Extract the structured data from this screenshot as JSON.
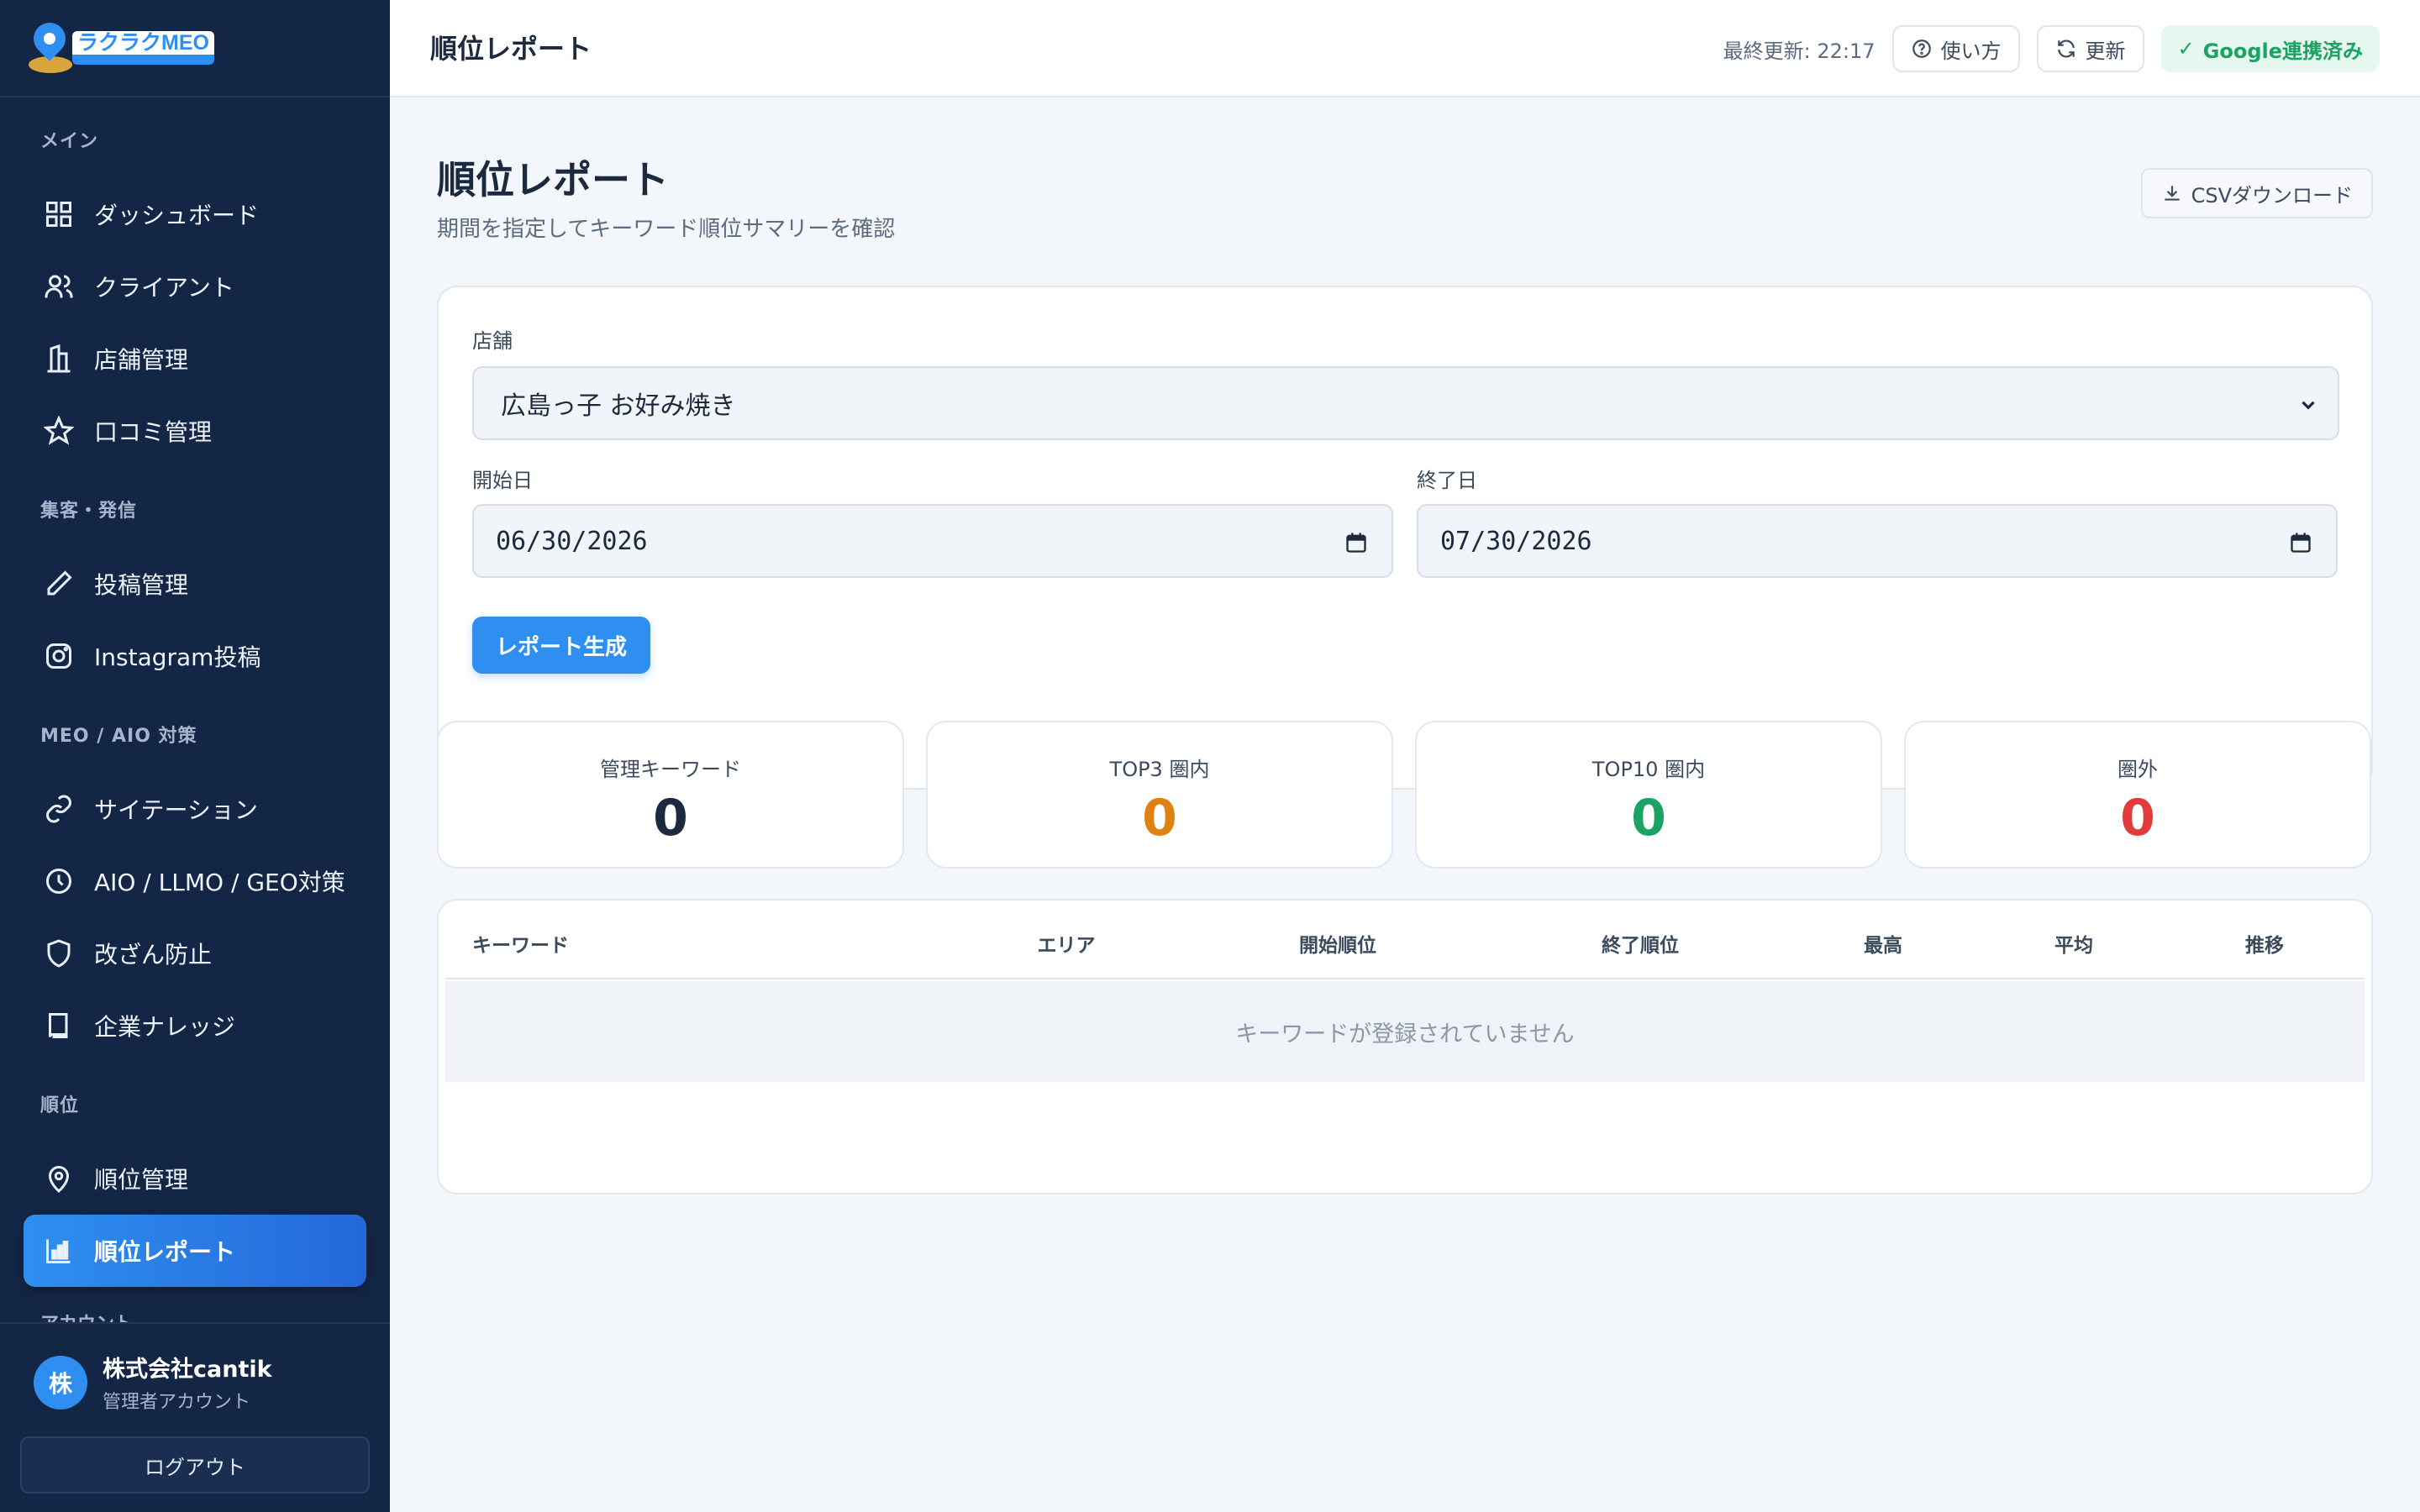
{
  "app": {
    "logo_text": "ラクラクMEO"
  },
  "sidebar": {
    "sections": [
      {
        "label": "メイン"
      },
      {
        "label": "集客・発信"
      },
      {
        "label": "MEO / AIO 対策"
      },
      {
        "label": "順位"
      },
      {
        "label": "アカウント"
      }
    ],
    "items": [
      {
        "label": "ダッシュボード",
        "icon": "grid-icon"
      },
      {
        "label": "クライアント",
        "icon": "users-icon"
      },
      {
        "label": "店舗管理",
        "icon": "building-icon"
      },
      {
        "label": "口コミ管理",
        "icon": "star-icon"
      },
      {
        "label": "投稿管理",
        "icon": "pencil-icon"
      },
      {
        "label": "Instagram投稿",
        "icon": "instagram-icon"
      },
      {
        "label": "サイテーション",
        "icon": "link-icon"
      },
      {
        "label": "AIO / LLMO / GEO対策",
        "icon": "clock-icon"
      },
      {
        "label": "改ざん防止",
        "icon": "shield-icon"
      },
      {
        "label": "企業ナレッジ",
        "icon": "book-icon"
      },
      {
        "label": "順位管理",
        "icon": "map-pin-icon"
      },
      {
        "label": "順位レポート",
        "icon": "bar-chart-icon",
        "active": true
      }
    ],
    "user": {
      "avatar_initial": "株",
      "name": "株式会社cantik",
      "role": "管理者アカウント"
    },
    "logout_label": "ログアウト"
  },
  "topbar": {
    "title": "順位レポート",
    "last_updated": "最終更新: 22:17",
    "help_label": "使い方",
    "refresh_label": "更新",
    "google_status": "Google連携済み",
    "google_status_color": "#1aa365"
  },
  "main": {
    "title": "順位レポート",
    "subtitle": "期間を指定してキーワード順位サマリーを確認",
    "csv_label": "CSVダウンロード",
    "filters": {
      "store_label": "店舗",
      "store_value": "広島っ子 お好み焼き",
      "start_label": "開始日",
      "start_value": "06/30/2026",
      "end_label": "終了日",
      "end_value": "07/30/2026",
      "generate_label": "レポート生成"
    },
    "stats": [
      {
        "label": "管理キーワード",
        "value": "0",
        "color": "#1c2a3f"
      },
      {
        "label": "TOP3 圏内",
        "value": "0",
        "color": "#e0820f"
      },
      {
        "label": "TOP10 圏内",
        "value": "0",
        "color": "#1aa365"
      },
      {
        "label": "圏外",
        "value": "0",
        "color": "#e23b3b"
      }
    ],
    "table": {
      "columns": [
        "キーワード",
        "エリア",
        "開始順位",
        "終了順位",
        "最高",
        "平均",
        "推移"
      ],
      "empty_message": "キーワードが登録されていません"
    }
  },
  "colors": {
    "sidebar_bg": "#142646",
    "accent": "#2f8ff0",
    "page_bg": "#f3f6fa"
  }
}
